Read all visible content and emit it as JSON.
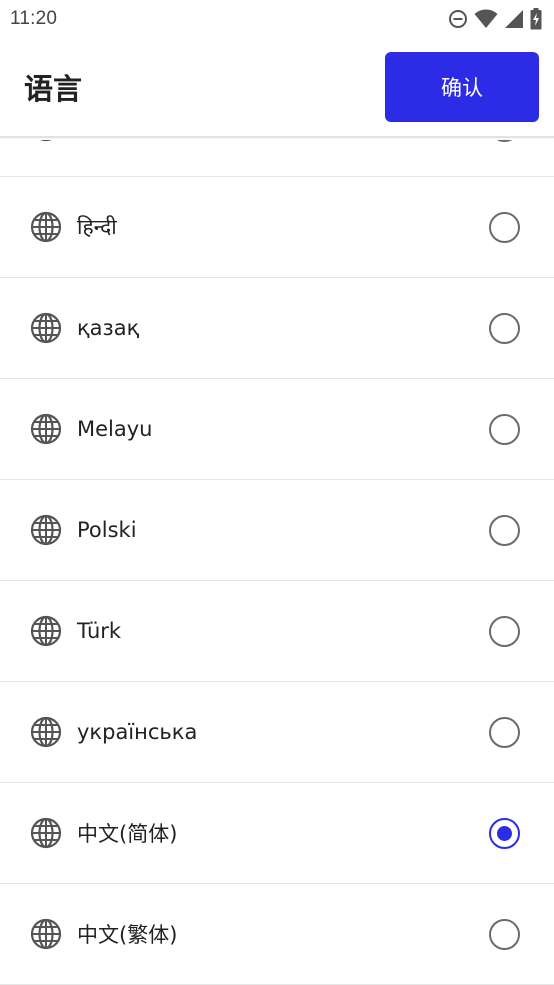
{
  "status_bar": {
    "time": "11:20",
    "icons": [
      "do-not-disturb-icon",
      "wifi-icon",
      "cell-signal-icon",
      "battery-charging-icon"
    ]
  },
  "header": {
    "title": "语言",
    "confirm_label": "确认"
  },
  "colors": {
    "accent": "#2c2ce6",
    "radio_border": "#6b6b6b",
    "divider": "#e6e6e6"
  },
  "languages": [
    {
      "label": "",
      "selected": false,
      "icon": "globe-icon"
    },
    {
      "label": "हिन्दी",
      "selected": false,
      "icon": "globe-icon"
    },
    {
      "label": "қазақ",
      "selected": false,
      "icon": "globe-icon"
    },
    {
      "label": "Melayu",
      "selected": false,
      "icon": "globe-icon"
    },
    {
      "label": "Polski",
      "selected": false,
      "icon": "globe-icon"
    },
    {
      "label": "Türk",
      "selected": false,
      "icon": "globe-icon"
    },
    {
      "label": "українська",
      "selected": false,
      "icon": "globe-icon"
    },
    {
      "label": "中文(简体)",
      "selected": true,
      "icon": "globe-icon"
    },
    {
      "label": "中文(繁体)",
      "selected": false,
      "icon": "globe-icon"
    }
  ]
}
